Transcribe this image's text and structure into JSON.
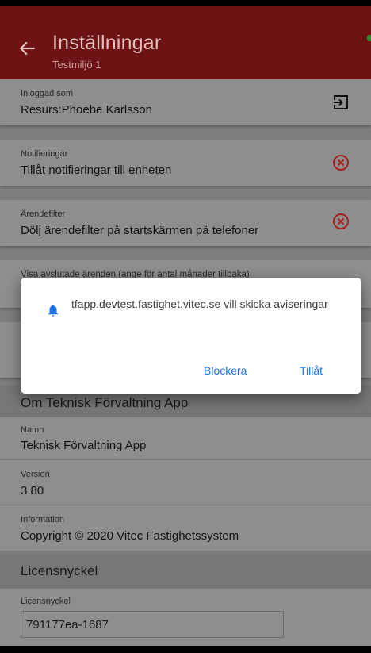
{
  "header": {
    "title": "Inställningar",
    "subtitle": "Testmiljö 1"
  },
  "settings": [
    {
      "label": "Inloggad som",
      "value": "Resurs:Phoebe Karlsson",
      "icon": "logout-icon"
    },
    {
      "label": "Notifieringar",
      "value": "Tillåt notifieringar till enheten",
      "icon": "close-circle-icon"
    },
    {
      "label": "Ärendefilter",
      "value": "Dölj ärendefilter på startskärmen på telefoner",
      "icon": "close-circle-icon"
    },
    {
      "label": "Visa avslutade ärenden (ange för antal månader tillbaka)"
    }
  ],
  "about": {
    "section_title": "Om Teknisk Förvaltning App",
    "rows": [
      {
        "label": "Namn",
        "value": "Teknisk Förvaltning App"
      },
      {
        "label": "Version",
        "value": "3.80"
      },
      {
        "label": "Information",
        "value": "Copyright © 2020 Vitec Fastighetssystem"
      }
    ]
  },
  "license": {
    "section_title": "Licensnyckel",
    "label": "Licensnyckel",
    "value": "791177ea-1687"
  },
  "dialog": {
    "message": "tfapp.devtest.fastighet.vitec.se vill skicka aviseringar",
    "block_label": "Blockera",
    "allow_label": "Tillåt"
  },
  "colors": {
    "header_bg": "#6d1313",
    "icon_red": "#a52020",
    "link_blue": "#1a73e8"
  }
}
